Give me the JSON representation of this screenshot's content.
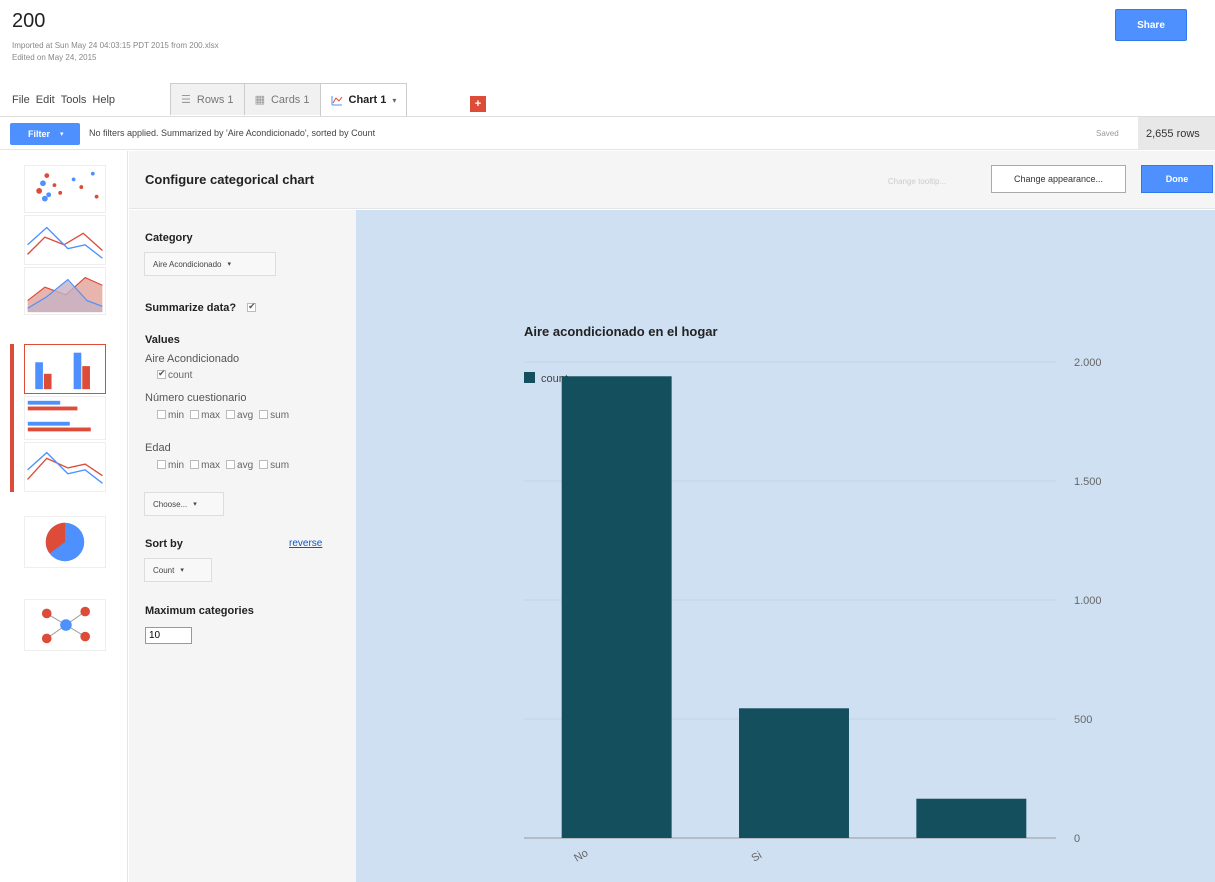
{
  "doc": {
    "title": "200",
    "imported": "Imported at Sun May 24 04:03:15 PDT 2015 from 200.xlsx",
    "edited": "Edited on May 24, 2015",
    "share_label": "Share"
  },
  "menu": [
    "File",
    "Edit",
    "Tools",
    "Help"
  ],
  "tabs": [
    {
      "label": "Rows 1",
      "icon": "rows-icon"
    },
    {
      "label": "Cards 1",
      "icon": "cards-icon"
    },
    {
      "label": "Chart 1",
      "icon": "chart-icon",
      "active": true
    }
  ],
  "add_tab_label": "+",
  "filter_bar": {
    "button_label": "Filter",
    "status": "No filters applied. Summarized by 'Aire Acondicionado', sorted by Count",
    "saved": "Saved",
    "rows": "2,655 rows"
  },
  "config": {
    "title": "Configure categorical chart",
    "change_tooltip": "Change tooltip...",
    "change_appearance": "Change appearance...",
    "done": "Done",
    "category_label": "Category",
    "category_value": "Aire Acondicionado",
    "summarize_label": "Summarize data?",
    "values_label": "Values",
    "value_groups": [
      {
        "name": "Aire Acondicionado",
        "options": [
          "count"
        ]
      },
      {
        "name": "Número cuestionario",
        "options": [
          "min",
          "max",
          "avg",
          "sum"
        ]
      },
      {
        "name": "Edad",
        "options": [
          "min",
          "max",
          "avg",
          "sum"
        ]
      }
    ],
    "choose_label": "Choose...",
    "sort_label": "Sort by",
    "reverse_label": "reverse",
    "sort_value": "Count",
    "max_categories_label": "Maximum categories",
    "max_categories_value": "10"
  },
  "colors": {
    "accent": "#4d90fe",
    "red": "#dd4b39",
    "bar": "#134f5c",
    "chart_bg": "#cfe0f2"
  },
  "chart_data": {
    "type": "bar",
    "title": "Aire acondicionado en el hogar",
    "categories": [
      "No",
      "Si",
      ""
    ],
    "series": [
      {
        "name": "count",
        "values": [
          1940,
          545,
          165
        ]
      }
    ],
    "ylim": [
      0,
      2000
    ],
    "yticks": [
      0,
      500,
      1000,
      1500,
      2000
    ],
    "ytick_labels": [
      "0",
      "500",
      "1.000",
      "1.500",
      "2.000"
    ],
    "grid": true,
    "legend": "top-left",
    "y_axis_position": "right",
    "xlabel": "",
    "ylabel": ""
  }
}
